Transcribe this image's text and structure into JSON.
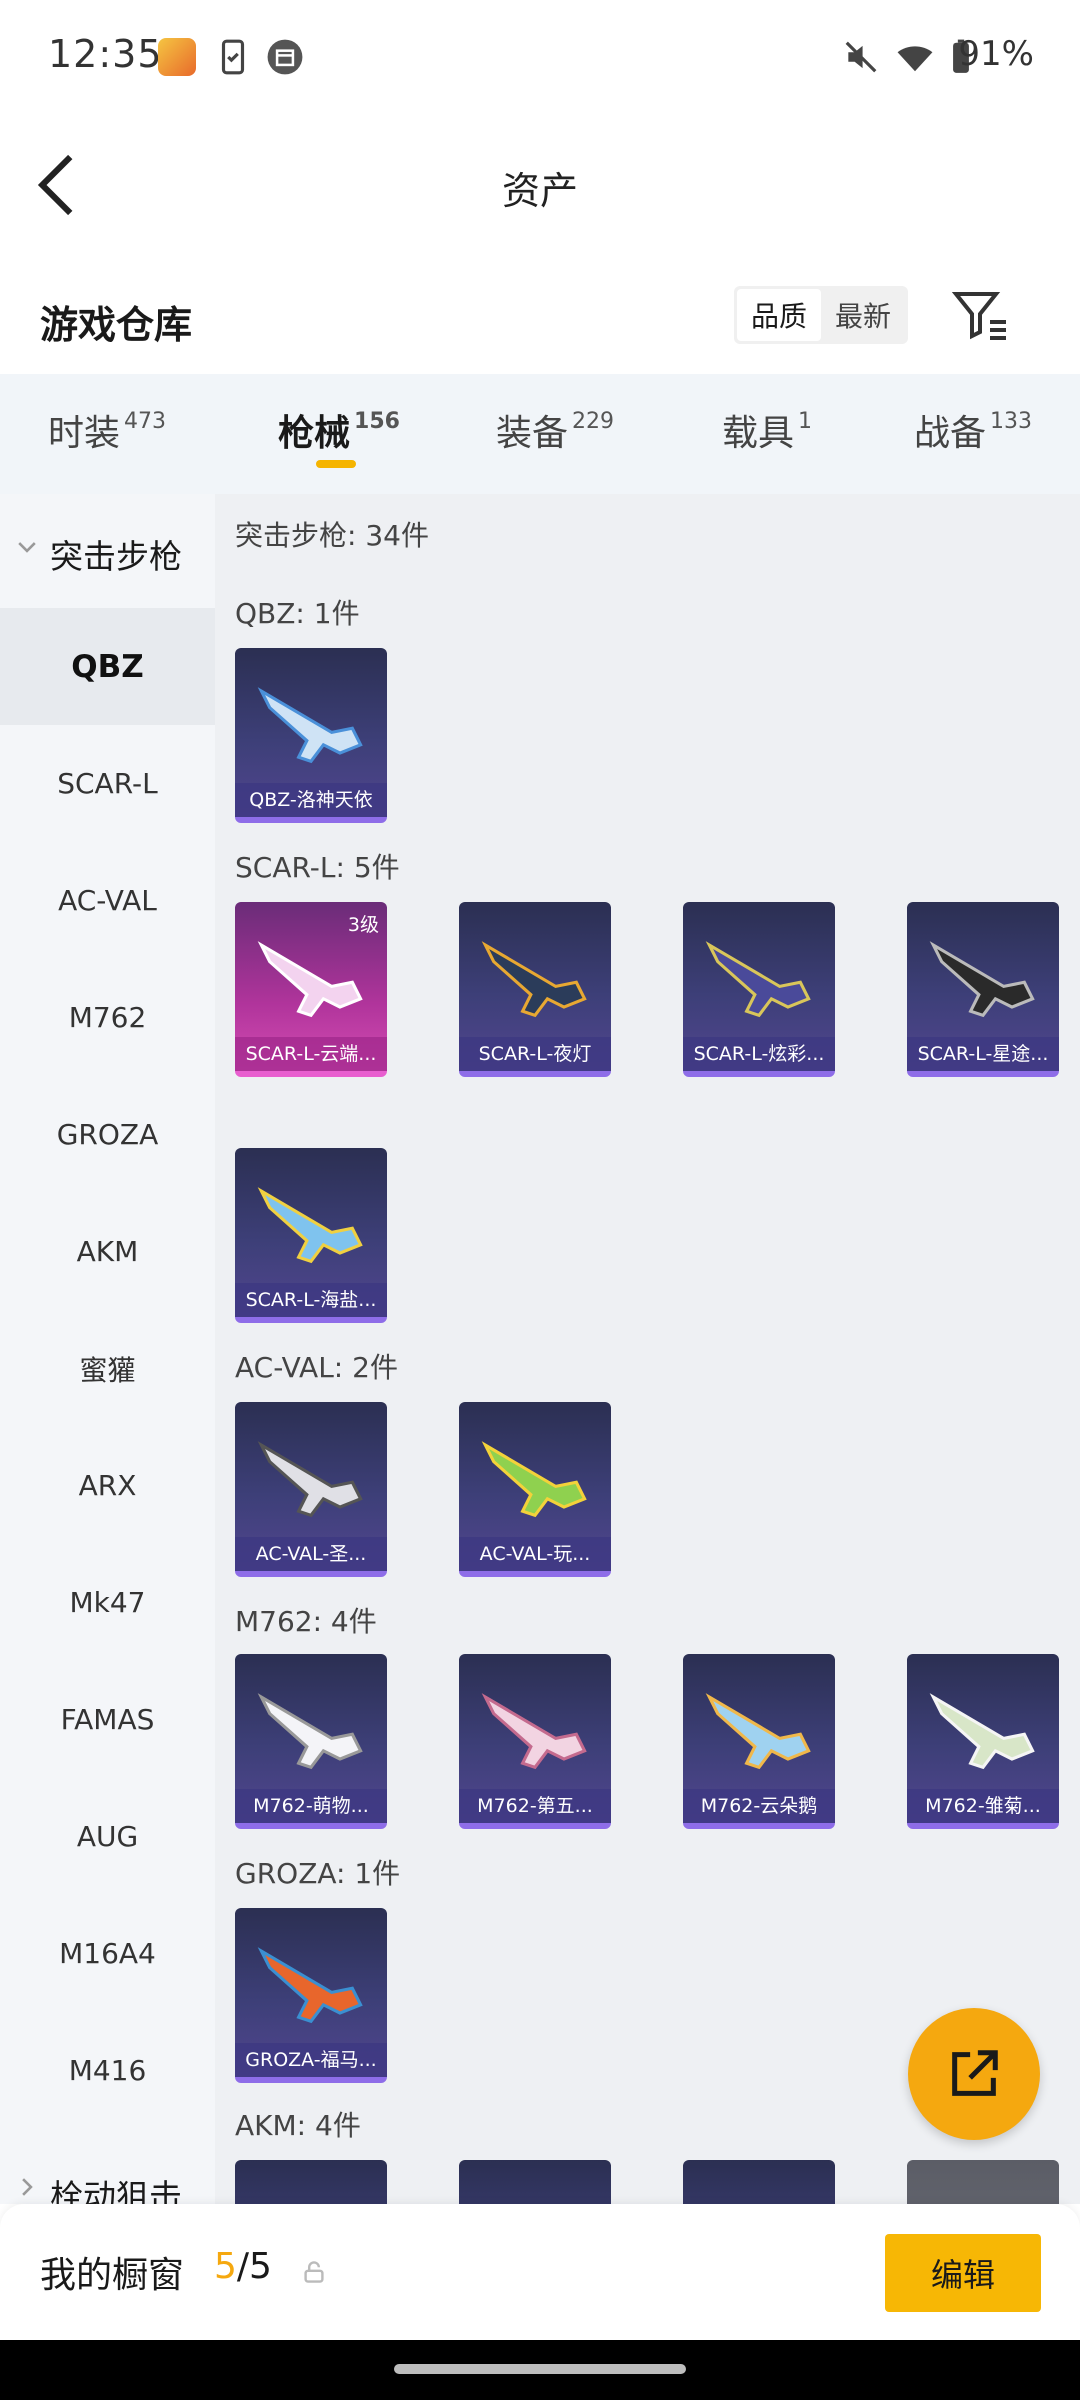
{
  "status_bar": {
    "time": "12:35",
    "battery": "91%",
    "icons": [
      "game-app-icon",
      "phone-sync-icon",
      "calendar-icon",
      "mute-icon",
      "wifi-icon",
      "battery-icon"
    ]
  },
  "header": {
    "title": "资产",
    "back_icon": "back-arrow-icon"
  },
  "section": {
    "title": "游戏仓库",
    "sort_options": [
      "品质",
      "最新"
    ],
    "sort_active": "品质",
    "filter_icon": "filter-icon"
  },
  "tabs": [
    {
      "label": "时装",
      "count": "473"
    },
    {
      "label": "枪械",
      "count": "156",
      "active": true
    },
    {
      "label": "装备",
      "count": "229"
    },
    {
      "label": "载具",
      "count": "1"
    },
    {
      "label": "战备",
      "count": "133"
    }
  ],
  "sidebar": {
    "group": "突击步枪",
    "items": [
      "QBZ",
      "SCAR-L",
      "AC-VAL",
      "M762",
      "GROZA",
      "AKM",
      "蜜獾",
      "ARX",
      "Mk47",
      "FAMAS",
      "AUG",
      "M16A4",
      "M416"
    ],
    "active": "QBZ",
    "next_group": "栓动狙击"
  },
  "content": {
    "summary": "突击步枪: 34件",
    "groups": [
      {
        "title": "QBZ: 1件",
        "items": [
          {
            "name": "QBZ-洛神天依"
          }
        ]
      },
      {
        "title": "SCAR-L: 5件",
        "items": [
          {
            "name": "SCAR-L-云端...",
            "level": "3级",
            "style": "pink"
          },
          {
            "name": "SCAR-L-夜灯"
          },
          {
            "name": "SCAR-L-炫彩..."
          },
          {
            "name": "SCAR-L-星途..."
          },
          {
            "name": "SCAR-L-海盐..."
          }
        ]
      },
      {
        "title": "AC-VAL: 2件",
        "items": [
          {
            "name": "AC-VAL-圣..."
          },
          {
            "name": "AC-VAL-玩..."
          }
        ]
      },
      {
        "title": "M762: 4件",
        "items": [
          {
            "name": "M762-萌物..."
          },
          {
            "name": "M762-第五..."
          },
          {
            "name": "M762-云朵鹅"
          },
          {
            "name": "M762-雏菊..."
          }
        ]
      },
      {
        "title": "GROZA: 1件",
        "items": [
          {
            "name": "GROZA-福马..."
          }
        ]
      },
      {
        "title": "AKM: 4件",
        "items": []
      }
    ]
  },
  "fab": {
    "icon": "share-external-icon"
  },
  "bottom": {
    "label": "我的橱窗",
    "current": "5",
    "total": "/5",
    "lock_icon": "lock-icon",
    "edit_label": "编辑"
  },
  "colors": {
    "accent": "#f5b400",
    "fab": "#f5a80f",
    "card_purple": "#3d3f78",
    "card_pink": "#b0349b"
  }
}
